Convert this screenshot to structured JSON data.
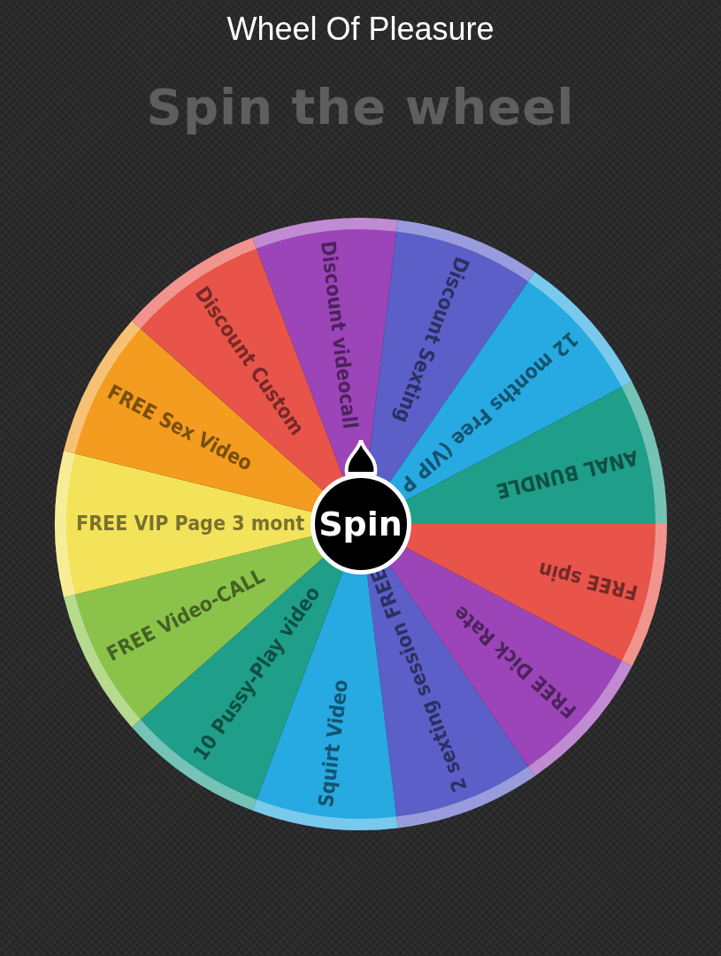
{
  "header": {
    "title": "Wheel Of Pleasure"
  },
  "heading": "Spin the wheel",
  "wheel": {
    "button": "Spin",
    "slices": [
      {
        "label": "FREE spin",
        "color": "#e8534a"
      },
      {
        "label": "FREE Dick Rate",
        "color": "#9b45b8"
      },
      {
        "label": "2 sexting session FREE",
        "color": "#5b5fc7"
      },
      {
        "label": "Squirt Video",
        "color": "#27a9e1"
      },
      {
        "label": "10 Pussy-Play video",
        "color": "#1f9e89"
      },
      {
        "label": "FREE Video-CALL",
        "color": "#8bc34a"
      },
      {
        "label": "FREE VIP Page 3 mont",
        "color": "#f3e35a"
      },
      {
        "label": "FREE Sex Video",
        "color": "#f39c1f"
      },
      {
        "label": "Discount Custom",
        "color": "#e8534a"
      },
      {
        "label": "Discount videocall",
        "color": "#9b45b8"
      },
      {
        "label": "Discount Sexting",
        "color": "#5b5fc7"
      },
      {
        "label": "12 months Free (VIP P",
        "color": "#27a9e1"
      },
      {
        "label": "ANAL BUNDLE",
        "color": "#1f9e89"
      }
    ]
  }
}
